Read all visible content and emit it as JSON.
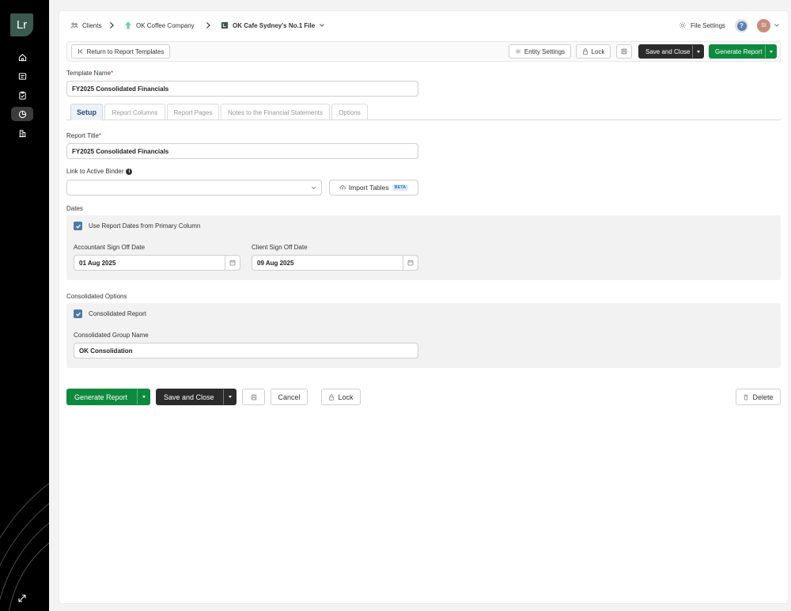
{
  "app": {
    "logo_text": "Lr"
  },
  "breadcrumb": {
    "clients": "Clients",
    "company": "OK Coffee Company",
    "file": "OK Cafe Sydney's No.1 File"
  },
  "header": {
    "file_settings": "File Settings",
    "help": "?",
    "avatar_initials": "SI"
  },
  "toolbar": {
    "return": "Return to Report Templates",
    "entity_settings": "Entity Settings",
    "lock": "Lock",
    "save_and_close": "Save and Close",
    "generate_report": "Generate Report"
  },
  "template": {
    "label": "Template Name",
    "required": "*",
    "value": "FY2025 Consolidated Financials"
  },
  "tabs": [
    {
      "label": "Setup"
    },
    {
      "label": "Report Columns"
    },
    {
      "label": "Report Pages"
    },
    {
      "label": "Notes to the Financial Statements"
    },
    {
      "label": "Options"
    }
  ],
  "setup": {
    "report_title_label": "Report Title",
    "required": "*",
    "report_title_value": "FY2025 Consolidated Financials",
    "binder_label": "Link to Active Binder",
    "binder_info": "i",
    "binder_value": "",
    "import_tables": "Import Tables",
    "beta": "BETA",
    "dates_heading": "Dates",
    "use_dates_label": "Use Report Dates from Primary Column",
    "accountant_label": "Accountant Sign Off Date",
    "accountant_value": "01 Aug 2025",
    "client_label": "Client Sign Off Date",
    "client_value": "09 Aug 2025",
    "consolidated_heading": "Consolidated Options",
    "consolidated_report_label": "Consolidated Report",
    "group_name_label": "Consolidated Group Name",
    "group_name_value": "OK Consolidation"
  },
  "footer": {
    "generate_report": "Generate Report",
    "save_and_close": "Save and Close",
    "cancel": "Cancel",
    "lock": "Lock",
    "delete": "Delete"
  },
  "colors": {
    "accent_green": "#0e8a3e",
    "dark_button": "#2b2b2b",
    "checkbox_blue": "#4f78a6",
    "sidebar": "#000000"
  }
}
